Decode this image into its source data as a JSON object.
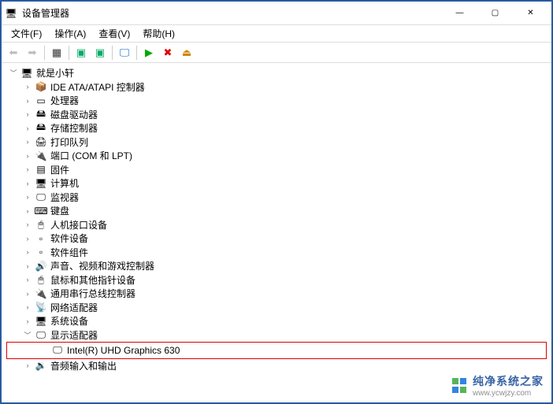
{
  "window": {
    "title": "设备管理器"
  },
  "menu": {
    "file": "文件(F)",
    "action": "操作(A)",
    "view": "查看(V)",
    "help": "帮助(H)"
  },
  "tree": {
    "root": "就是小轩",
    "nodes": [
      {
        "label": "IDE ATA/ATAPI 控制器",
        "icon": "📦"
      },
      {
        "label": "处理器",
        "icon": "▭"
      },
      {
        "label": "磁盘驱动器",
        "icon": "🖴"
      },
      {
        "label": "存储控制器",
        "icon": "🖴"
      },
      {
        "label": "打印队列",
        "icon": "🖨"
      },
      {
        "label": "端口 (COM 和 LPT)",
        "icon": "🔌"
      },
      {
        "label": "固件",
        "icon": "▤"
      },
      {
        "label": "计算机",
        "icon": "🖥"
      },
      {
        "label": "监视器",
        "icon": "🖵"
      },
      {
        "label": "键盘",
        "icon": "⌨"
      },
      {
        "label": "人机接口设备",
        "icon": "🖱"
      },
      {
        "label": "软件设备",
        "icon": "▫"
      },
      {
        "label": "软件组件",
        "icon": "▫"
      },
      {
        "label": "声音、视频和游戏控制器",
        "icon": "🔊"
      },
      {
        "label": "鼠标和其他指针设备",
        "icon": "🖱"
      },
      {
        "label": "通用串行总线控制器",
        "icon": "🔌"
      },
      {
        "label": "网络适配器",
        "icon": "📡"
      },
      {
        "label": "系统设备",
        "icon": "🖥"
      }
    ],
    "display_adapter": {
      "label": "显示适配器",
      "child": "Intel(R) UHD Graphics 630"
    },
    "audio": "音频输入和输出"
  },
  "watermark": {
    "text": "纯净系统之家",
    "url": "www.ycwjzy.com"
  }
}
